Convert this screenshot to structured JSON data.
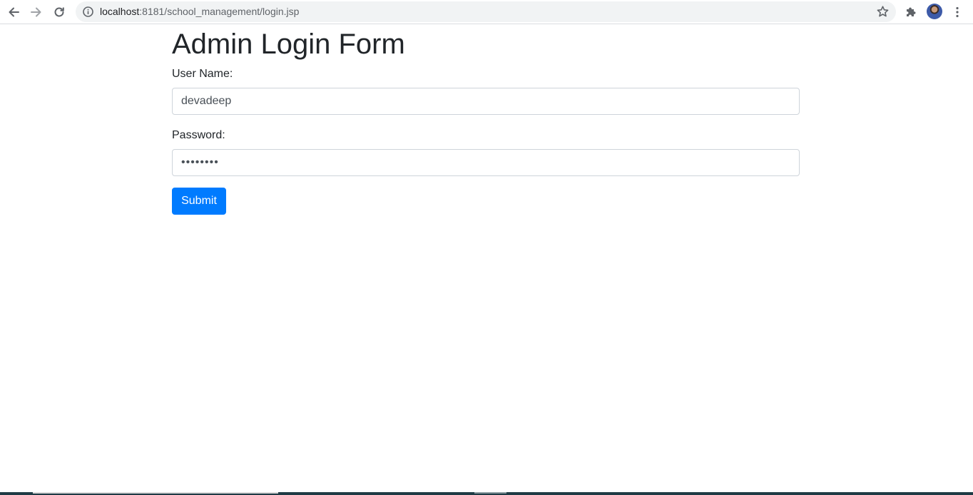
{
  "browser": {
    "url_host": "localhost",
    "url_rest": ":8181/school_management/login.jsp",
    "icons": {
      "back": "back-arrow-icon",
      "forward": "forward-arrow-icon",
      "reload": "reload-icon",
      "info": "info-icon",
      "bookmark": "star-icon",
      "extensions": "puzzle-icon",
      "menu": "kebab-menu-icon"
    }
  },
  "form": {
    "title": "Admin Login Form",
    "username_label": "User Name:",
    "username_value": "devadeep",
    "password_label": "Password:",
    "password_value": "••••••••",
    "submit_label": "Submit"
  },
  "colors": {
    "primary": "#007bff",
    "text": "#212529",
    "input_border": "#ced4da"
  }
}
